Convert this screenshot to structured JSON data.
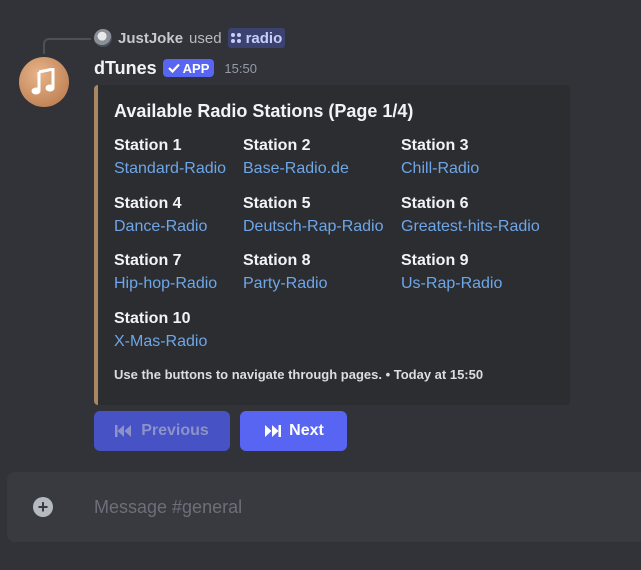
{
  "reply": {
    "user": "JustJoke",
    "verb": "used",
    "command": "radio"
  },
  "message": {
    "author": "dTunes",
    "badge": "APP",
    "time": "15:50"
  },
  "embed": {
    "title": "Available Radio Stations (Page 1/4)",
    "accent": "#a88761",
    "stations": [
      {
        "name": "Station 1",
        "link": "Standard-Radio"
      },
      {
        "name": "Station 2",
        "link": "Base-Radio.de"
      },
      {
        "name": "Station 3",
        "link": "Chill-Radio"
      },
      {
        "name": "Station 4",
        "link": "Dance-Radio"
      },
      {
        "name": "Station 5",
        "link": "Deutsch-Rap-Radio"
      },
      {
        "name": "Station 6",
        "link": "Greatest-hits-Radio"
      },
      {
        "name": "Station 7",
        "link": "Hip-hop-Radio"
      },
      {
        "name": "Station 8",
        "link": "Party-Radio"
      },
      {
        "name": "Station 9",
        "link": "Us-Rap-Radio"
      },
      {
        "name": "Station 10",
        "link": "X-Mas-Radio"
      }
    ],
    "footer": "Use the buttons to navigate through pages. • Today at 15:50"
  },
  "buttons": {
    "previous": "Previous",
    "next": "Next"
  },
  "composer": {
    "placeholder": "Message #general"
  },
  "colors": {
    "background": "#313338",
    "embed_bg": "#2b2d31",
    "link": "#6ea6e8",
    "blurple": "#5865f2"
  }
}
